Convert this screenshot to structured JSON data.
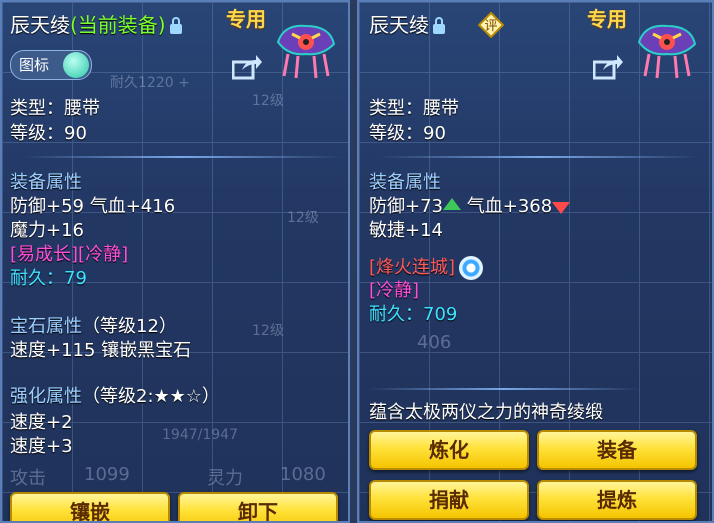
{
  "left": {
    "name": "辰天绫",
    "equipped_tag": "(当前装备)",
    "exclusive": "专用",
    "icon_toggle": "图标",
    "type_line": "类型：腰带",
    "level_line": "等级：90",
    "equip_attr_title": "装备属性",
    "attr1": "防御+59 气血+416",
    "attr2": "魔力+16",
    "special": "[易成长][冷静]",
    "durability": "耐久：79",
    "gem_title": "宝石属性",
    "gem_level": "（等级12）",
    "gem_line": "速度+115 镶嵌黑宝石",
    "enhance_title": "强化属性",
    "enhance_level": "（等级2:★★☆）",
    "enhance1": "速度+2",
    "enhance2": "速度+3",
    "bg_texts": {
      "b1": "12级",
      "b2": "12级",
      "b3": "12级",
      "b4": "1947/1947",
      "b5": "攻击",
      "b6": "1099",
      "b7": "灵力",
      "b8": "1080",
      "b9": "耐久1220 +"
    },
    "buttons": {
      "inlay": "镶嵌",
      "unload": "卸下"
    }
  },
  "right": {
    "name": "辰天绫",
    "eval_badge": "评",
    "exclusive": "专用",
    "type_line": "类型：腰带",
    "level_line": "等级：90",
    "equip_attr_title": "装备属性",
    "def": "防御+73",
    "hp": "气血+368",
    "attr2": "敏捷+14",
    "special1": "[烽火连城]",
    "special2": "[冷静]",
    "durability": "耐久：709",
    "bg_texts": {
      "b1": "406"
    },
    "description": "蕴含太极两仪之力的神奇绫缎",
    "buttons": {
      "refine": "炼化",
      "equip": "装备",
      "donate": "捐献",
      "extract": "提炼"
    }
  }
}
